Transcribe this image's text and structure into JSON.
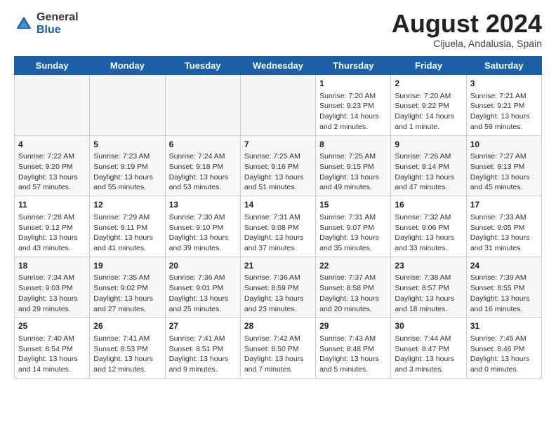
{
  "header": {
    "logo_general": "General",
    "logo_blue": "Blue",
    "month_title": "August 2024",
    "location": "Cijuela, Andalusia, Spain"
  },
  "weekdays": [
    "Sunday",
    "Monday",
    "Tuesday",
    "Wednesday",
    "Thursday",
    "Friday",
    "Saturday"
  ],
  "weeks": [
    [
      {
        "day": "",
        "info": ""
      },
      {
        "day": "",
        "info": ""
      },
      {
        "day": "",
        "info": ""
      },
      {
        "day": "",
        "info": ""
      },
      {
        "day": "1",
        "info": "Sunrise: 7:20 AM\nSunset: 9:23 PM\nDaylight: 14 hours\nand 2 minutes."
      },
      {
        "day": "2",
        "info": "Sunrise: 7:20 AM\nSunset: 9:22 PM\nDaylight: 14 hours\nand 1 minute."
      },
      {
        "day": "3",
        "info": "Sunrise: 7:21 AM\nSunset: 9:21 PM\nDaylight: 13 hours\nand 59 minutes."
      }
    ],
    [
      {
        "day": "4",
        "info": "Sunrise: 7:22 AM\nSunset: 9:20 PM\nDaylight: 13 hours\nand 57 minutes."
      },
      {
        "day": "5",
        "info": "Sunrise: 7:23 AM\nSunset: 9:19 PM\nDaylight: 13 hours\nand 55 minutes."
      },
      {
        "day": "6",
        "info": "Sunrise: 7:24 AM\nSunset: 9:18 PM\nDaylight: 13 hours\nand 53 minutes."
      },
      {
        "day": "7",
        "info": "Sunrise: 7:25 AM\nSunset: 9:16 PM\nDaylight: 13 hours\nand 51 minutes."
      },
      {
        "day": "8",
        "info": "Sunrise: 7:25 AM\nSunset: 9:15 PM\nDaylight: 13 hours\nand 49 minutes."
      },
      {
        "day": "9",
        "info": "Sunrise: 7:26 AM\nSunset: 9:14 PM\nDaylight: 13 hours\nand 47 minutes."
      },
      {
        "day": "10",
        "info": "Sunrise: 7:27 AM\nSunset: 9:13 PM\nDaylight: 13 hours\nand 45 minutes."
      }
    ],
    [
      {
        "day": "11",
        "info": "Sunrise: 7:28 AM\nSunset: 9:12 PM\nDaylight: 13 hours\nand 43 minutes."
      },
      {
        "day": "12",
        "info": "Sunrise: 7:29 AM\nSunset: 9:11 PM\nDaylight: 13 hours\nand 41 minutes."
      },
      {
        "day": "13",
        "info": "Sunrise: 7:30 AM\nSunset: 9:10 PM\nDaylight: 13 hours\nand 39 minutes."
      },
      {
        "day": "14",
        "info": "Sunrise: 7:31 AM\nSunset: 9:08 PM\nDaylight: 13 hours\nand 37 minutes."
      },
      {
        "day": "15",
        "info": "Sunrise: 7:31 AM\nSunset: 9:07 PM\nDaylight: 13 hours\nand 35 minutes."
      },
      {
        "day": "16",
        "info": "Sunrise: 7:32 AM\nSunset: 9:06 PM\nDaylight: 13 hours\nand 33 minutes."
      },
      {
        "day": "17",
        "info": "Sunrise: 7:33 AM\nSunset: 9:05 PM\nDaylight: 13 hours\nand 31 minutes."
      }
    ],
    [
      {
        "day": "18",
        "info": "Sunrise: 7:34 AM\nSunset: 9:03 PM\nDaylight: 13 hours\nand 29 minutes."
      },
      {
        "day": "19",
        "info": "Sunrise: 7:35 AM\nSunset: 9:02 PM\nDaylight: 13 hours\nand 27 minutes."
      },
      {
        "day": "20",
        "info": "Sunrise: 7:36 AM\nSunset: 9:01 PM\nDaylight: 13 hours\nand 25 minutes."
      },
      {
        "day": "21",
        "info": "Sunrise: 7:36 AM\nSunset: 8:59 PM\nDaylight: 13 hours\nand 23 minutes."
      },
      {
        "day": "22",
        "info": "Sunrise: 7:37 AM\nSunset: 8:58 PM\nDaylight: 13 hours\nand 20 minutes."
      },
      {
        "day": "23",
        "info": "Sunrise: 7:38 AM\nSunset: 8:57 PM\nDaylight: 13 hours\nand 18 minutes."
      },
      {
        "day": "24",
        "info": "Sunrise: 7:39 AM\nSunset: 8:55 PM\nDaylight: 13 hours\nand 16 minutes."
      }
    ],
    [
      {
        "day": "25",
        "info": "Sunrise: 7:40 AM\nSunset: 8:54 PM\nDaylight: 13 hours\nand 14 minutes."
      },
      {
        "day": "26",
        "info": "Sunrise: 7:41 AM\nSunset: 8:53 PM\nDaylight: 13 hours\nand 12 minutes."
      },
      {
        "day": "27",
        "info": "Sunrise: 7:41 AM\nSunset: 8:51 PM\nDaylight: 13 hours\nand 9 minutes."
      },
      {
        "day": "28",
        "info": "Sunrise: 7:42 AM\nSunset: 8:50 PM\nDaylight: 13 hours\nand 7 minutes."
      },
      {
        "day": "29",
        "info": "Sunrise: 7:43 AM\nSunset: 8:48 PM\nDaylight: 13 hours\nand 5 minutes."
      },
      {
        "day": "30",
        "info": "Sunrise: 7:44 AM\nSunset: 8:47 PM\nDaylight: 13 hours\nand 3 minutes."
      },
      {
        "day": "31",
        "info": "Sunrise: 7:45 AM\nSunset: 8:46 PM\nDaylight: 13 hours\nand 0 minutes."
      }
    ]
  ]
}
